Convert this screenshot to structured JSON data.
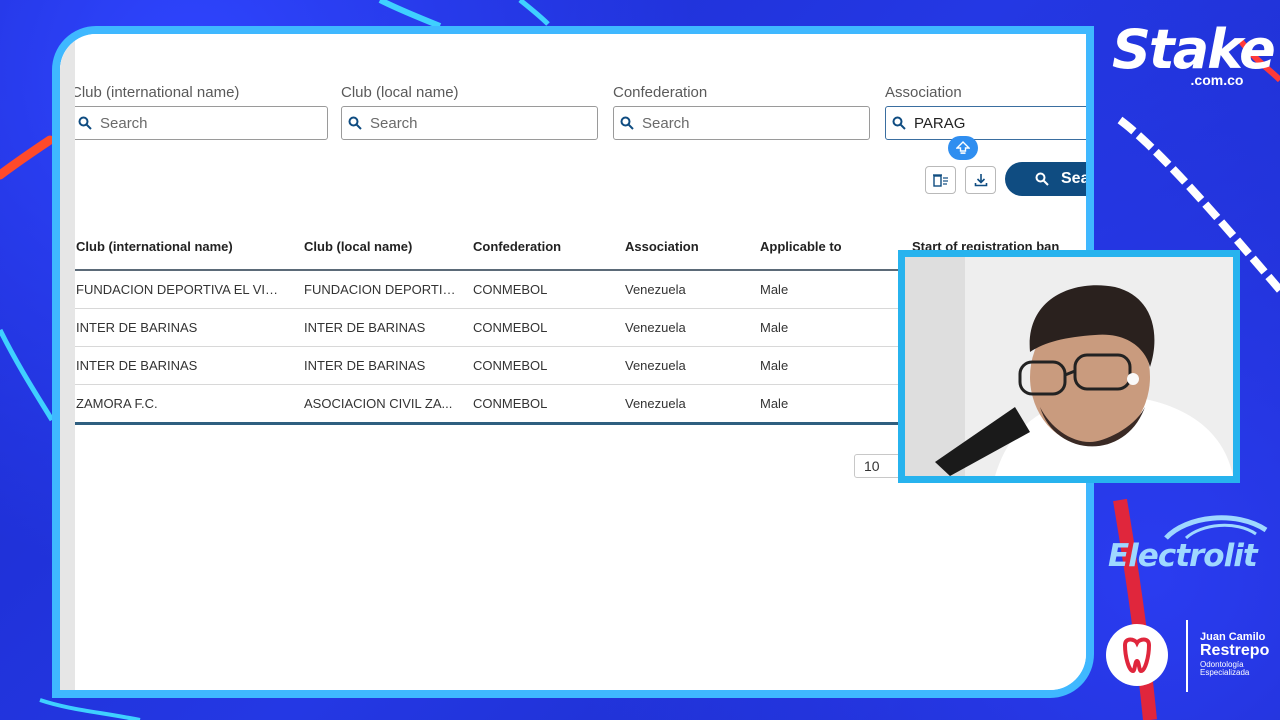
{
  "filters": [
    {
      "label": "Club (international name)",
      "value": "",
      "placeholder": "Search"
    },
    {
      "label": "Club (local name)",
      "value": "",
      "placeholder": "Search"
    },
    {
      "label": "Confederation",
      "value": "",
      "placeholder": "Search"
    },
    {
      "label": "Association",
      "value": "PARAG",
      "placeholder": "Search"
    }
  ],
  "toolbar": {
    "search_label": "Sea"
  },
  "table": {
    "headers": [
      "Club (international name)",
      "Club (local name)",
      "Confederation",
      "Association",
      "Applicable to",
      "Start of registration ban"
    ],
    "rows": [
      [
        "FUNDACION DEPORTIVA EL VIGIA",
        "FUNDACION DEPORTIV...",
        "CONMEBOL",
        "Venezuela",
        "Male",
        ""
      ],
      [
        "INTER DE BARINAS",
        "INTER DE BARINAS",
        "CONMEBOL",
        "Venezuela",
        "Male",
        ""
      ],
      [
        "INTER DE BARINAS",
        "INTER DE BARINAS",
        "CONMEBOL",
        "Venezuela",
        "Male",
        ""
      ],
      [
        "ZAMORA F.C.",
        "ASOCIACION CIVIL ZA...",
        "CONMEBOL",
        "Venezuela",
        "Male",
        ""
      ]
    ]
  },
  "pagination": {
    "page_size": "10"
  },
  "overlay": {
    "sponsor1_name": "Stake",
    "sponsor1_domain": ".com.co",
    "sponsor2_name": "Electrolit",
    "sponsor3_line1": "Juan Camilo",
    "sponsor3_line2": "Restrepo",
    "sponsor3_line3": "Odontología",
    "sponsor3_line4": "Especializada"
  },
  "colors": {
    "brand_blue": "#0f4c81",
    "frame_accent": "#3fb8ff",
    "background": "#1f2fd0"
  }
}
